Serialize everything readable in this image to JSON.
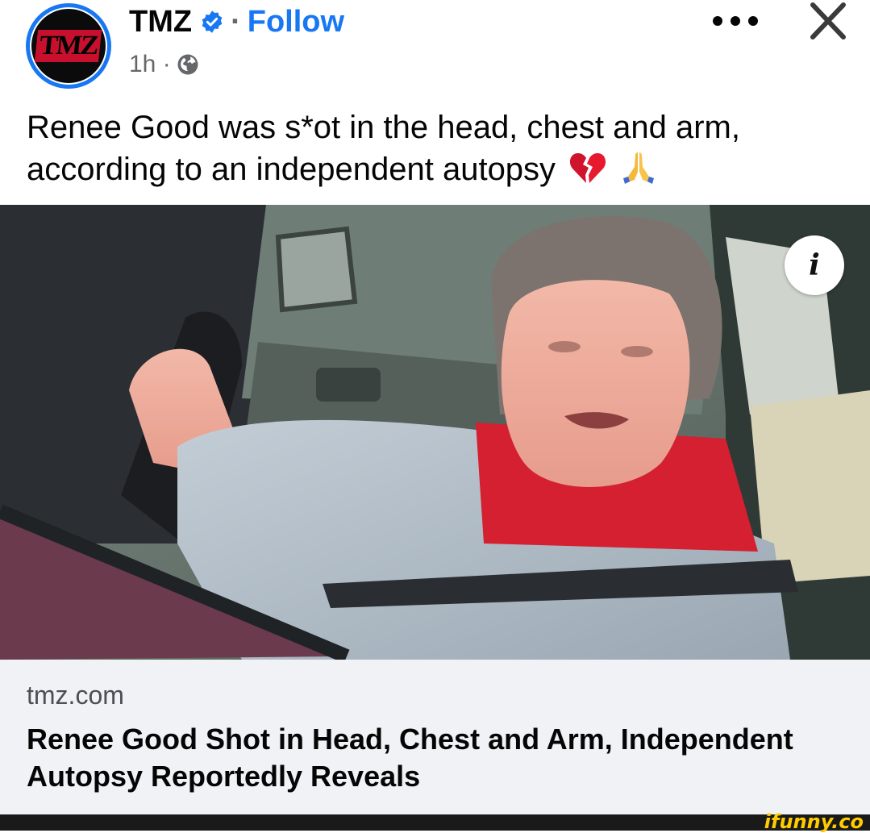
{
  "post": {
    "page_name": "TMZ",
    "follow_label": "Follow",
    "separator": "·",
    "timestamp": "1h ·",
    "avatar_text": "TMZ",
    "caption": "Renee Good was s*ot in the head, chest and arm, according to an independent autopsy",
    "caption_emojis": [
      "broken-heart-icon",
      "praying-hands-icon"
    ]
  },
  "link": {
    "domain": "tmz.com",
    "title": "Renee Good Shot in Head, Chest and Arm, Independent Autopsy Reportedly Reveals"
  },
  "photo": {
    "info_label": "i"
  },
  "watermark": "ifunny.co",
  "colors": {
    "facebook_blue": "#1877f2",
    "tmz_red": "#c8102e",
    "meta_gray": "#65676b",
    "card_bg": "#f0f2f5"
  }
}
